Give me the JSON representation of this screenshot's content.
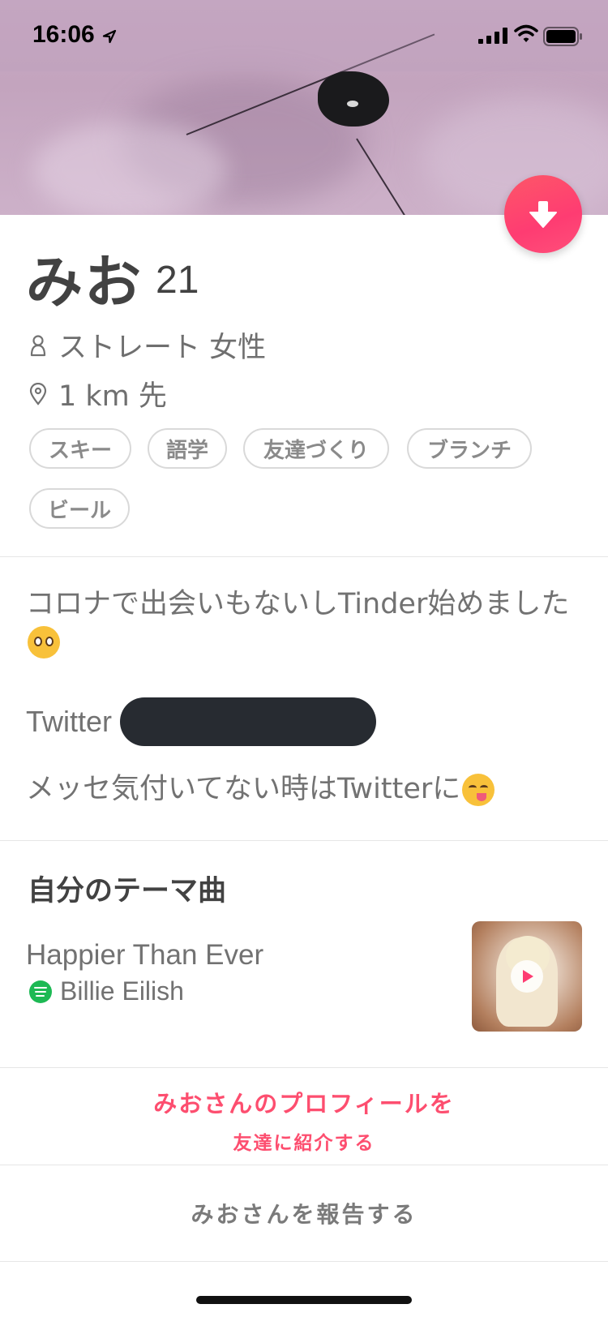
{
  "status_bar": {
    "time": "16:06",
    "icons": [
      "location-arrow-icon",
      "cellular-signal-icon",
      "wifi-icon",
      "battery-icon"
    ]
  },
  "photo": {
    "description_icon": "profile-photo"
  },
  "fab": {
    "icon": "arrow-down-icon",
    "color_start": "#fd5768",
    "color_end": "#fe3c72"
  },
  "profile": {
    "name": "みお",
    "age": "21",
    "orientation_gender": "ストレート 女性",
    "distance": "1 km 先"
  },
  "interests": [
    "スキー",
    "語学",
    "友達づくり",
    "ブランチ",
    "ビール"
  ],
  "bio": {
    "line1": "コロナで出会いもないしTinder始めました",
    "twitter_label": "Twitter",
    "line3": "メッセ気付いてない時はTwitterに"
  },
  "anthem": {
    "section_title": "自分のテーマ曲",
    "song": "Happier Than Ever",
    "artist": "Billie Eilish"
  },
  "actions": {
    "share_line1": "みおさんのプロフィールを",
    "share_line2": "友達に紹介する",
    "report": "みおさんを報告する"
  },
  "colors": {
    "accent": "#fd4e6f",
    "text_dark": "#424242",
    "text_muted": "#727272"
  }
}
